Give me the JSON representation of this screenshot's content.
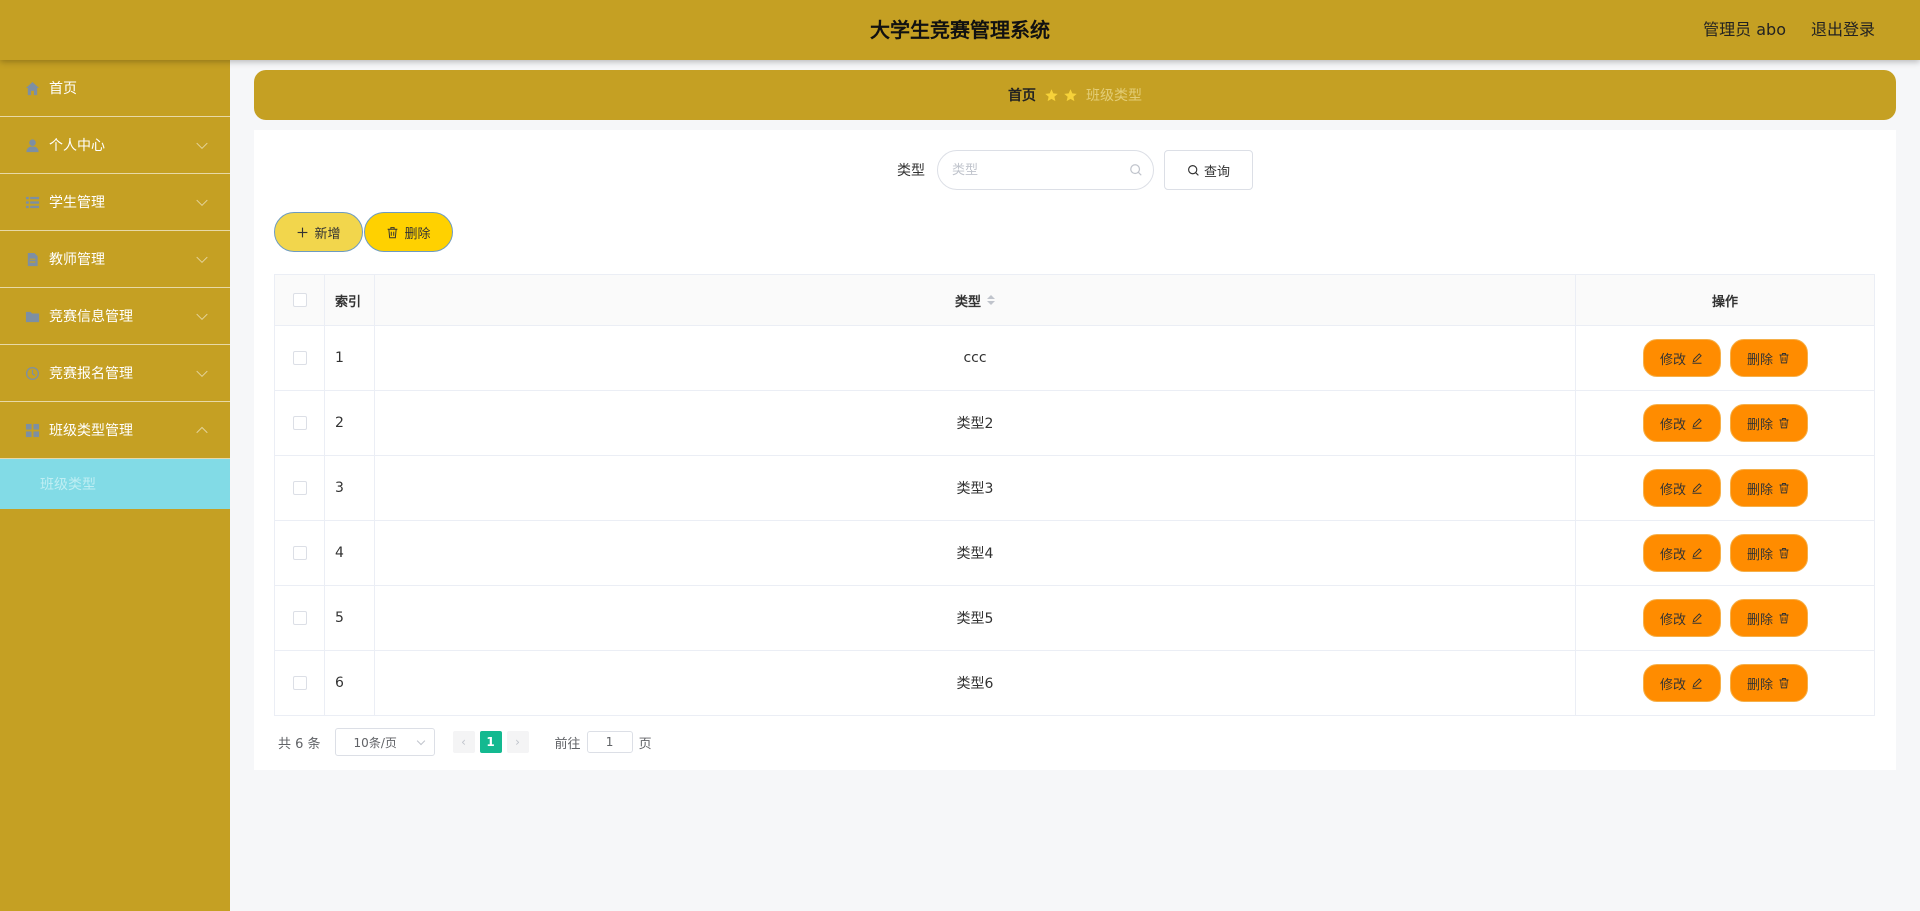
{
  "header": {
    "title": "大学生竞赛管理系统",
    "user": "管理员 abo",
    "logout": "退出登录"
  },
  "sidebar": {
    "items": [
      {
        "label": "首页",
        "icon": "home-icon"
      },
      {
        "label": "个人中心",
        "icon": "user-icon"
      },
      {
        "label": "学生管理",
        "icon": "list-icon"
      },
      {
        "label": "教师管理",
        "icon": "document-icon"
      },
      {
        "label": "竞赛信息管理",
        "icon": "folder-icon"
      },
      {
        "label": "竞赛报名管理",
        "icon": "clock-icon"
      },
      {
        "label": "班级类型管理",
        "icon": "grid-icon"
      }
    ],
    "sub_item": "班级类型"
  },
  "breadcrumb": {
    "home": "首页",
    "current": "班级类型"
  },
  "search": {
    "label": "类型",
    "placeholder": "类型",
    "button": "查询"
  },
  "actions": {
    "add": "新增",
    "delete": "删除"
  },
  "table": {
    "headers": {
      "index": "索引",
      "type": "类型",
      "ops": "操作"
    },
    "edit_label": "修改",
    "delete_label": "删除",
    "rows": [
      {
        "index": "1",
        "type": "ccc"
      },
      {
        "index": "2",
        "type": "类型2"
      },
      {
        "index": "3",
        "type": "类型3"
      },
      {
        "index": "4",
        "type": "类型4"
      },
      {
        "index": "5",
        "type": "类型5"
      },
      {
        "index": "6",
        "type": "类型6"
      }
    ]
  },
  "pagination": {
    "total": "共 6 条",
    "page_size": "10条/页",
    "current_page": "1",
    "goto_label": "前往",
    "goto_value": "1",
    "page_suffix": "页"
  },
  "colors": {
    "brand": "#c5a023",
    "active_sub": "#82dbe6",
    "op_button": "#ff8c00",
    "page_active": "#13b990"
  }
}
